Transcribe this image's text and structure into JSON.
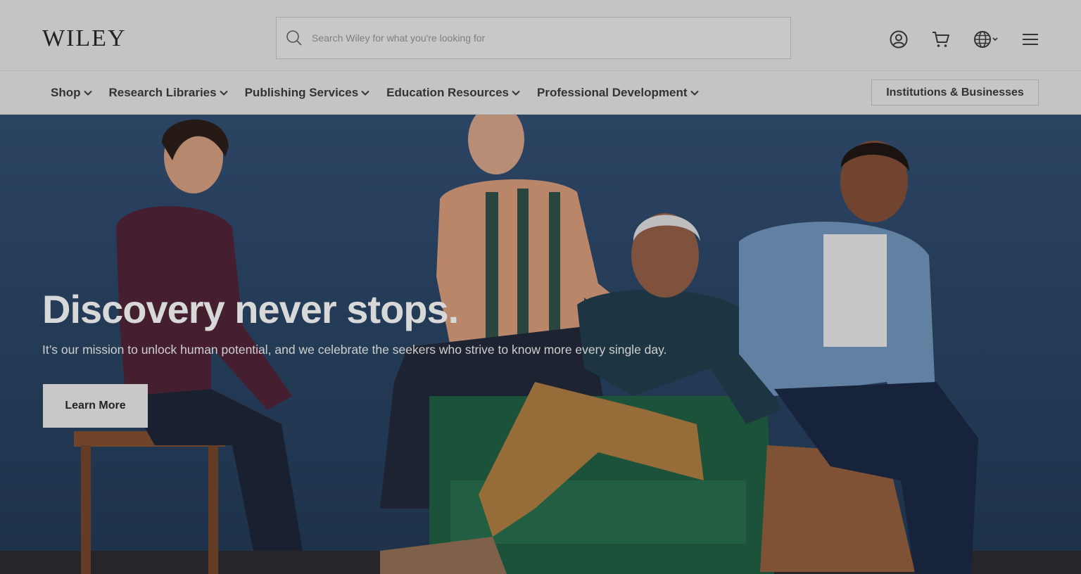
{
  "header": {
    "logo_text": "WILEY",
    "search": {
      "placeholder": "Search Wiley for what you're looking for"
    },
    "icons": [
      "account-icon",
      "cart-icon",
      "globe-icon",
      "menu-icon"
    ]
  },
  "nav": {
    "items": [
      {
        "label": "Shop"
      },
      {
        "label": "Research Libraries"
      },
      {
        "label": "Publishing Services"
      },
      {
        "label": "Education Resources"
      },
      {
        "label": "Professional Development"
      }
    ],
    "institutions_label": "Institutions & Businesses"
  },
  "hero": {
    "headline": "Discovery never stops.",
    "subline": "It’s our mission to unlock human potential, and we celebrate the seekers who strive to know more every single day.",
    "cta_label": "Learn More",
    "image": "four-people-seated-photo"
  },
  "colors": {
    "header_bg": "#c4c4c4",
    "hero_wall": "#2f4a6b",
    "text_dark": "#333333"
  }
}
